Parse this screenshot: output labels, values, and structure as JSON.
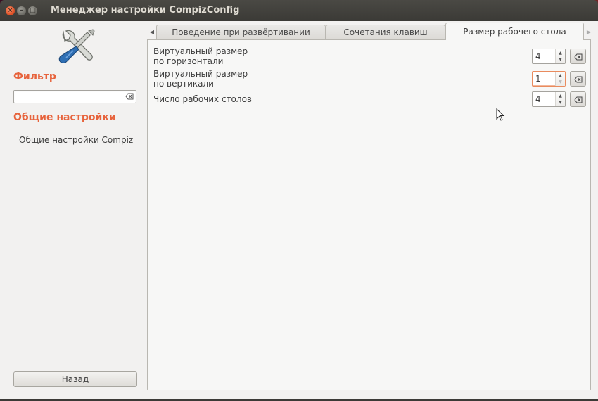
{
  "window": {
    "title": "Менеджер настройки CompizConfig"
  },
  "sidebar": {
    "logo_icon": "preferences-tools-icon",
    "filter_title": "Фильтр",
    "filter_value": "",
    "filter_placeholder": "",
    "category_title": "Общие настройки",
    "categories": [
      {
        "label": "Общие настройки Compiz"
      }
    ],
    "back_label": "Назад"
  },
  "tabs": [
    {
      "label": "Поведение при развёртивании",
      "active": false
    },
    {
      "label": "Сочетания клавиш",
      "active": false
    },
    {
      "label": "Размер рабочего стола",
      "active": true
    }
  ],
  "settings": [
    {
      "label_line1": "Виртуальный размер",
      "label_line2": "по горизонтали",
      "value": "4"
    },
    {
      "label_line1": "Виртуальный размер",
      "label_line2": "по вертикали",
      "value": "1",
      "focused": true
    },
    {
      "label_line1": "Число рабочих столов",
      "label_line2": "",
      "value": "4"
    }
  ],
  "colors": {
    "accent": "#e7633c",
    "titlebar": "#3b3a36",
    "background": "#f2f1f0"
  }
}
